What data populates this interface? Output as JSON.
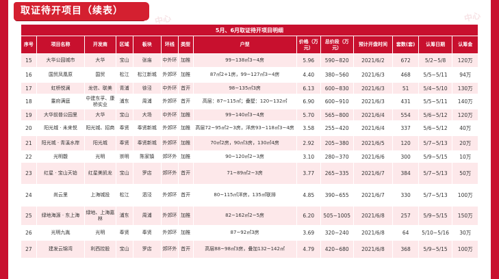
{
  "page": {
    "title": "取证待开项目（续表）",
    "watermark": "中心"
  },
  "table": {
    "caption": "5月、6月取证待开项目明细",
    "columns": [
      "序号",
      "项目名称",
      "开发商",
      "区域",
      "板块",
      "环线",
      "类型",
      "户型",
      "价格（万元）",
      "总价段（万元）",
      "预计开盘时间",
      "套数(套)",
      "认筹日期",
      "认筹金"
    ],
    "rows": [
      [
        "15",
        "大华公园城市",
        "大华",
        "宝山",
        "张庙",
        "中外环",
        "加推",
        "99~138㎡3~4房",
        "5.96",
        "590~820",
        "2021/6/2",
        "672",
        "5/2~5/8",
        "120万"
      ],
      [
        "16",
        "国贸凤凰原",
        "国贸",
        "松江",
        "松江新城",
        "外郊环",
        "加推",
        "87㎡2+1房，99~127㎡3~4房",
        "4.40",
        "380~560",
        "2021/6/3",
        "468",
        "5/5~5/11",
        "94万"
      ],
      [
        "17",
        "虹桥悦澜",
        "龙信、联美",
        "青浦",
        "徐泾",
        "中外环",
        "首开",
        "98~135㎡3房",
        "6.13",
        "600~830",
        "2021/6/3",
        "51",
        "5/4~5/10",
        "130万"
      ],
      [
        "18",
        "耋府满庭",
        "中建东孚、康桥实业",
        "浦东",
        "周浦",
        "外郊环",
        "首开",
        "高层：87~115㎡；叠墅：120~132㎡",
        "6.90",
        "600~910",
        "2021/6/3",
        "431",
        "5/5~5/11",
        "140万"
      ],
      [
        "19",
        "大华前普公园里",
        "大华",
        "宝山",
        "大场",
        "中外环",
        "加推",
        "99~140㎡3~4房",
        "5.70",
        "565~800",
        "2021/6/4",
        "554",
        "5/6~5/12",
        "120万"
      ],
      [
        "20",
        "阳光城 · 未来悦",
        "阳光城、招商",
        "奉贤",
        "奉贤新城",
        "外郊环",
        "加推",
        "高层72~95㎡2~3房，洋房93~118㎡3~4房",
        "3.58",
        "255~420",
        "2021/6/4",
        "337",
        "5/6~5/12",
        "40万"
      ],
      [
        "21",
        "阳光城 · 青溪水岸",
        "阳光城",
        "奉贤",
        "奉贤新城",
        "外郊环",
        "加推",
        "70㎡2房，90㎡3房，130㎡4房",
        "2.92",
        "205~380",
        "2021/6/5",
        "120",
        "5/7~5/13",
        "20万"
      ],
      [
        "22",
        "光明馥",
        "光明",
        "崇明",
        "陈家镇",
        "郊环外",
        "加推",
        "90~120㎡2~3房",
        "3.10",
        "280~370",
        "2021/6/6",
        "300",
        "5/9~5/15",
        "10万"
      ],
      [
        "23",
        "红星 · 宝山天铂",
        "红星美凯龙",
        "宝山",
        "罗店",
        "郊环外",
        "首开",
        "71~89㎡2~3房",
        "3.77",
        "265~335",
        "2021/6/7",
        "384",
        "5/7~5/13",
        "50万"
      ],
      [
        "24",
        "尚云里",
        "上海城投",
        "松江",
        "泗泾",
        "外郊环",
        "首开",
        "80~115㎡洋房，135㎡联排",
        "4.85",
        "390~655",
        "2021/6/7",
        "330",
        "5/7~5/13",
        "100万"
      ],
      [
        "25",
        "绿地海源 · 东上海",
        "绿地、上海嘉林",
        "浦东",
        "周浦",
        "外郊环",
        "加推",
        "82~162㎡2~5房",
        "6.20",
        "505~1005",
        "2021/6/8",
        "257",
        "5/9~5/15",
        "150万"
      ],
      [
        "26",
        "光明九胤",
        "光明",
        "奉贤",
        "奉贤",
        "外郊环",
        "加推",
        "87~92㎡3房",
        "3.69",
        "320~240",
        "2021/6/8",
        "64",
        "5/10~5/16",
        "30万"
      ],
      [
        "27",
        "建发云锦湾",
        "利西控股",
        "宝山",
        "罗店",
        "郊环外",
        "首开",
        "高层88~98㎡3房，叠加132~142㎡",
        "4.79",
        "420~680",
        "2021/6/8",
        "368",
        "5/9~5/15",
        "100万"
      ]
    ]
  }
}
